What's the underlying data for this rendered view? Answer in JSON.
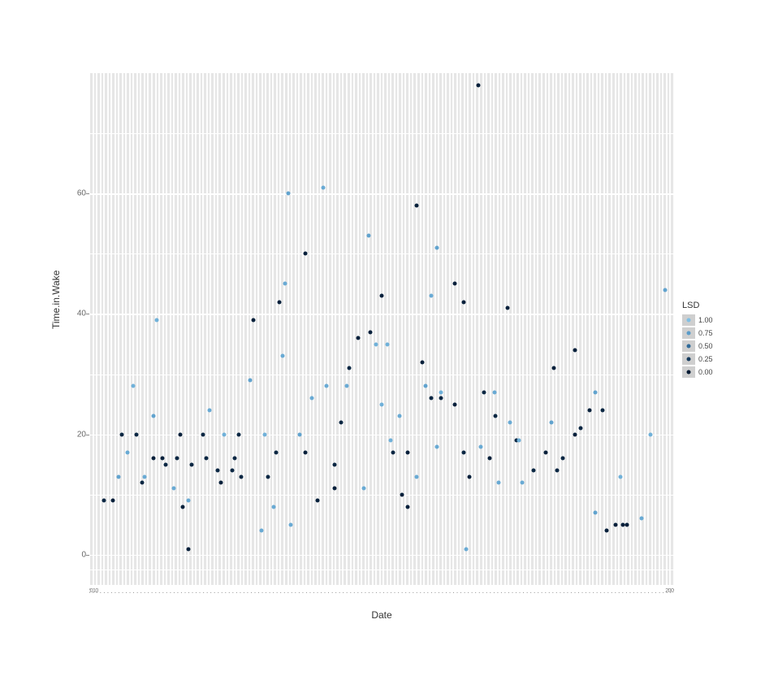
{
  "chart_data": {
    "type": "scatter",
    "xlabel": "Date",
    "ylabel": "Time.in.Wake",
    "ylim": [
      -5,
      80
    ],
    "xlim": [
      0,
      1
    ],
    "y_ticks": [
      0,
      20,
      40,
      60
    ],
    "x_tick_left": "2010",
    "x_tick_right": "2009",
    "legend": {
      "title": "LSD",
      "min": 0.0,
      "max": 1.0,
      "stops": [
        {
          "value": 1.0,
          "color": "#7fbfe4"
        },
        {
          "value": 0.75,
          "color": "#5a9cc9"
        },
        {
          "value": 0.5,
          "color": "#2f6a99"
        },
        {
          "value": 0.25,
          "color": "#153a5c"
        },
        {
          "value": 0.0,
          "color": "#041a33"
        }
      ]
    },
    "series": [
      {
        "name": "points",
        "color_field": "LSD",
        "points": [
          {
            "x": 0.025,
            "y": 9,
            "lsd": 0.1
          },
          {
            "x": 0.04,
            "y": 9,
            "lsd": 0.05
          },
          {
            "x": 0.05,
            "y": 13,
            "lsd": 0.8
          },
          {
            "x": 0.055,
            "y": 20,
            "lsd": 0.1
          },
          {
            "x": 0.065,
            "y": 17,
            "lsd": 0.85
          },
          {
            "x": 0.075,
            "y": 28,
            "lsd": 0.9
          },
          {
            "x": 0.08,
            "y": 20,
            "lsd": 0.1
          },
          {
            "x": 0.09,
            "y": 12,
            "lsd": 0.1
          },
          {
            "x": 0.095,
            "y": 13,
            "lsd": 0.85
          },
          {
            "x": 0.11,
            "y": 23,
            "lsd": 0.8
          },
          {
            "x": 0.11,
            "y": 16,
            "lsd": 0.05
          },
          {
            "x": 0.115,
            "y": 39,
            "lsd": 0.9
          },
          {
            "x": 0.125,
            "y": 16,
            "lsd": 0.05
          },
          {
            "x": 0.13,
            "y": 15,
            "lsd": 0.1
          },
          {
            "x": 0.145,
            "y": 11,
            "lsd": 0.85
          },
          {
            "x": 0.15,
            "y": 16,
            "lsd": 0.1
          },
          {
            "x": 0.155,
            "y": 20,
            "lsd": 0.05
          },
          {
            "x": 0.16,
            "y": 8,
            "lsd": 0.05
          },
          {
            "x": 0.17,
            "y": 9,
            "lsd": 0.85
          },
          {
            "x": 0.17,
            "y": 1,
            "lsd": 0.05
          },
          {
            "x": 0.175,
            "y": 15,
            "lsd": 0.1
          },
          {
            "x": 0.195,
            "y": 20,
            "lsd": 0.1
          },
          {
            "x": 0.2,
            "y": 16,
            "lsd": 0.1
          },
          {
            "x": 0.205,
            "y": 24,
            "lsd": 0.85
          },
          {
            "x": 0.22,
            "y": 14,
            "lsd": 0.1
          },
          {
            "x": 0.225,
            "y": 12,
            "lsd": 0.05
          },
          {
            "x": 0.23,
            "y": 20,
            "lsd": 0.9
          },
          {
            "x": 0.245,
            "y": 14,
            "lsd": 0.1
          },
          {
            "x": 0.248,
            "y": 16,
            "lsd": 0.1
          },
          {
            "x": 0.255,
            "y": 20,
            "lsd": 0.1
          },
          {
            "x": 0.26,
            "y": 13,
            "lsd": 0.1
          },
          {
            "x": 0.275,
            "y": 29,
            "lsd": 0.8
          },
          {
            "x": 0.28,
            "y": 39,
            "lsd": 0.05
          },
          {
            "x": 0.295,
            "y": 4,
            "lsd": 0.85
          },
          {
            "x": 0.3,
            "y": 20,
            "lsd": 0.9
          },
          {
            "x": 0.305,
            "y": 13,
            "lsd": 0.1
          },
          {
            "x": 0.315,
            "y": 8,
            "lsd": 0.85
          },
          {
            "x": 0.32,
            "y": 17,
            "lsd": 0.1
          },
          {
            "x": 0.325,
            "y": 42,
            "lsd": 0.05
          },
          {
            "x": 0.33,
            "y": 33,
            "lsd": 0.85
          },
          {
            "x": 0.335,
            "y": 45,
            "lsd": 0.85
          },
          {
            "x": 0.34,
            "y": 60,
            "lsd": 0.8
          },
          {
            "x": 0.345,
            "y": 5,
            "lsd": 0.85
          },
          {
            "x": 0.36,
            "y": 20,
            "lsd": 0.8
          },
          {
            "x": 0.37,
            "y": 50,
            "lsd": 0.05
          },
          {
            "x": 0.37,
            "y": 17,
            "lsd": 0.05
          },
          {
            "x": 0.38,
            "y": 26,
            "lsd": 0.85
          },
          {
            "x": 0.39,
            "y": 9,
            "lsd": 0.05
          },
          {
            "x": 0.4,
            "y": 61,
            "lsd": 0.85
          },
          {
            "x": 0.405,
            "y": 28,
            "lsd": 0.85
          },
          {
            "x": 0.42,
            "y": 11,
            "lsd": 0.05
          },
          {
            "x": 0.42,
            "y": 15,
            "lsd": 0.1
          },
          {
            "x": 0.43,
            "y": 22,
            "lsd": 0.1
          },
          {
            "x": 0.44,
            "y": 28,
            "lsd": 0.85
          },
          {
            "x": 0.445,
            "y": 31,
            "lsd": 0.1
          },
          {
            "x": 0.46,
            "y": 36,
            "lsd": 0.05
          },
          {
            "x": 0.47,
            "y": 11,
            "lsd": 0.85
          },
          {
            "x": 0.478,
            "y": 53,
            "lsd": 0.8
          },
          {
            "x": 0.48,
            "y": 37,
            "lsd": 0.05
          },
          {
            "x": 0.49,
            "y": 35,
            "lsd": 0.9
          },
          {
            "x": 0.5,
            "y": 25,
            "lsd": 0.9
          },
          {
            "x": 0.5,
            "y": 43,
            "lsd": 0.05
          },
          {
            "x": 0.51,
            "y": 35,
            "lsd": 0.9
          },
          {
            "x": 0.515,
            "y": 19,
            "lsd": 0.9
          },
          {
            "x": 0.52,
            "y": 17,
            "lsd": 0.1
          },
          {
            "x": 0.53,
            "y": 23,
            "lsd": 0.85
          },
          {
            "x": 0.535,
            "y": 10,
            "lsd": 0.05
          },
          {
            "x": 0.545,
            "y": 8,
            "lsd": 0.05
          },
          {
            "x": 0.545,
            "y": 17,
            "lsd": 0.05
          },
          {
            "x": 0.56,
            "y": 58,
            "lsd": 0.05
          },
          {
            "x": 0.56,
            "y": 13,
            "lsd": 0.85
          },
          {
            "x": 0.57,
            "y": 32,
            "lsd": 0.05
          },
          {
            "x": 0.575,
            "y": 28,
            "lsd": 0.8
          },
          {
            "x": 0.585,
            "y": 43,
            "lsd": 0.85
          },
          {
            "x": 0.585,
            "y": 26,
            "lsd": 0.1
          },
          {
            "x": 0.595,
            "y": 51,
            "lsd": 0.8
          },
          {
            "x": 0.595,
            "y": 18,
            "lsd": 0.85
          },
          {
            "x": 0.602,
            "y": 26,
            "lsd": 0.1
          },
          {
            "x": 0.602,
            "y": 27,
            "lsd": 0.9
          },
          {
            "x": 0.625,
            "y": 45,
            "lsd": 0.05
          },
          {
            "x": 0.625,
            "y": 25,
            "lsd": 0.05
          },
          {
            "x": 0.64,
            "y": 42,
            "lsd": 0.05
          },
          {
            "x": 0.64,
            "y": 17,
            "lsd": 0.1
          },
          {
            "x": 0.645,
            "y": 1,
            "lsd": 0.85
          },
          {
            "x": 0.65,
            "y": 13,
            "lsd": 0.05
          },
          {
            "x": 0.665,
            "y": 78,
            "lsd": 0.05
          },
          {
            "x": 0.67,
            "y": 18,
            "lsd": 0.85
          },
          {
            "x": 0.675,
            "y": 27,
            "lsd": 0.1
          },
          {
            "x": 0.685,
            "y": 16,
            "lsd": 0.05
          },
          {
            "x": 0.693,
            "y": 27,
            "lsd": 0.85
          },
          {
            "x": 0.695,
            "y": 23,
            "lsd": 0.1
          },
          {
            "x": 0.7,
            "y": 12,
            "lsd": 0.85
          },
          {
            "x": 0.715,
            "y": 41,
            "lsd": 0.05
          },
          {
            "x": 0.72,
            "y": 22,
            "lsd": 0.85
          },
          {
            "x": 0.73,
            "y": 19,
            "lsd": 0.1
          },
          {
            "x": 0.735,
            "y": 19,
            "lsd": 0.9
          },
          {
            "x": 0.74,
            "y": 12,
            "lsd": 0.85
          },
          {
            "x": 0.76,
            "y": 14,
            "lsd": 0.1
          },
          {
            "x": 0.78,
            "y": 17,
            "lsd": 0.05
          },
          {
            "x": 0.79,
            "y": 22,
            "lsd": 0.8
          },
          {
            "x": 0.795,
            "y": 31,
            "lsd": 0.05
          },
          {
            "x": 0.8,
            "y": 14,
            "lsd": 0.1
          },
          {
            "x": 0.81,
            "y": 16,
            "lsd": 0.1
          },
          {
            "x": 0.83,
            "y": 34,
            "lsd": 0.05
          },
          {
            "x": 0.83,
            "y": 20,
            "lsd": 0.05
          },
          {
            "x": 0.84,
            "y": 21,
            "lsd": 0.1
          },
          {
            "x": 0.855,
            "y": 24,
            "lsd": 0.05
          },
          {
            "x": 0.865,
            "y": 27,
            "lsd": 0.8
          },
          {
            "x": 0.865,
            "y": 7,
            "lsd": 0.8
          },
          {
            "x": 0.878,
            "y": 24,
            "lsd": 0.1
          },
          {
            "x": 0.885,
            "y": 4,
            "lsd": 0.05
          },
          {
            "x": 0.9,
            "y": 5,
            "lsd": 0.05
          },
          {
            "x": 0.908,
            "y": 13,
            "lsd": 0.9
          },
          {
            "x": 0.912,
            "y": 5,
            "lsd": 0.05
          },
          {
            "x": 0.92,
            "y": 5,
            "lsd": 0.05
          },
          {
            "x": 0.945,
            "y": 6,
            "lsd": 0.85
          },
          {
            "x": 0.96,
            "y": 20,
            "lsd": 0.9
          },
          {
            "x": 0.985,
            "y": 44,
            "lsd": 0.8
          }
        ]
      }
    ]
  }
}
